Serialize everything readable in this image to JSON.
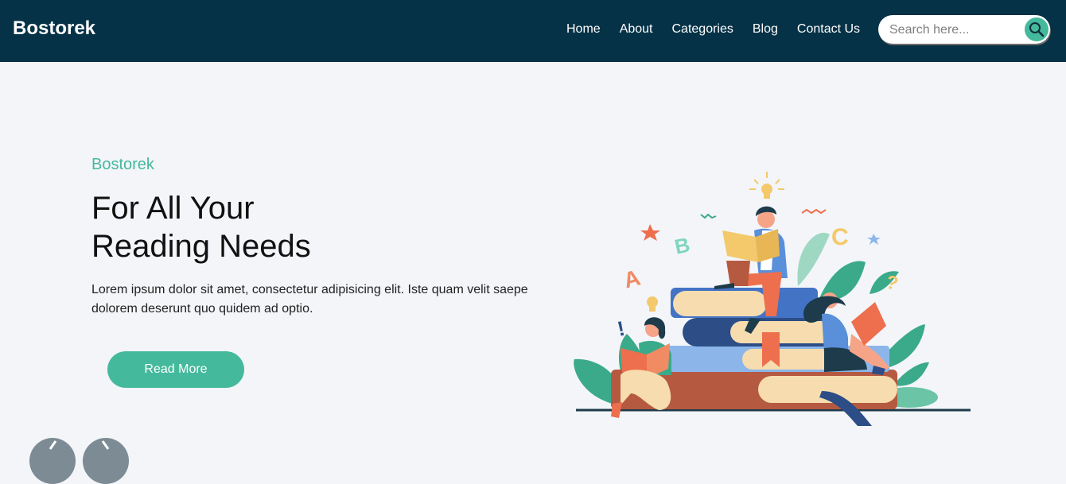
{
  "header": {
    "brand": "Bostorek",
    "nav": [
      "Home",
      "About",
      "Categories",
      "Blog",
      "Contact Us"
    ],
    "search": {
      "placeholder": "Search here..."
    }
  },
  "hero": {
    "eyebrow": "Bostorek",
    "title_lines": [
      "For All Your",
      "Reading Needs"
    ],
    "description": "Lorem ipsum dolor sit amet, consectetur adipisicing elit. Iste quam velit saepe dolorem deserunt quo quidem ad optio.",
    "cta_label": "Read More"
  },
  "colors": {
    "header_bg": "#063247",
    "accent": "#45b99c",
    "page_bg": "#f3f5f9"
  },
  "icons": {
    "search": "search-icon",
    "prev": "chevron-left-icon",
    "next": "chevron-right-icon"
  }
}
